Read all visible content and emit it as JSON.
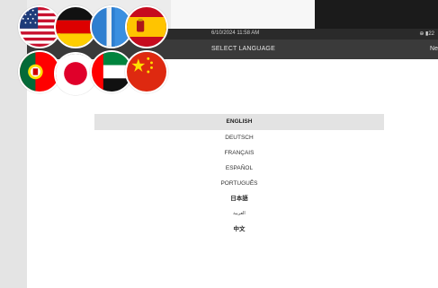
{
  "status_bar": {
    "datetime": "6/10/2024 11:58 AM",
    "icons_text": "⊕ ▮22"
  },
  "header": {
    "title": "SELECT LANGUAGE",
    "next_label": "Ne"
  },
  "languages": [
    {
      "label": "ENGLISH",
      "selected": true
    },
    {
      "label": "DEUTSCH",
      "selected": false
    },
    {
      "label": "FRANÇAIS",
      "selected": false
    },
    {
      "label": "ESPAÑOL",
      "selected": false
    },
    {
      "label": "PORTUGUÊS",
      "selected": false
    },
    {
      "label": "日本語",
      "selected": false
    },
    {
      "label": "العربية",
      "selected": false
    },
    {
      "label": "中文",
      "selected": false
    }
  ],
  "flags": [
    "usa-flag-icon",
    "germany-flag-icon",
    "blue-flag-icon",
    "spain-flag-icon",
    "portugal-flag-icon",
    "japan-flag-icon",
    "uae-flag-icon",
    "china-flag-icon"
  ],
  "colors": {
    "titlebar": "#3a3a3a",
    "statusbar": "#2a2a2a",
    "selected_row": "#e3e3e3"
  }
}
